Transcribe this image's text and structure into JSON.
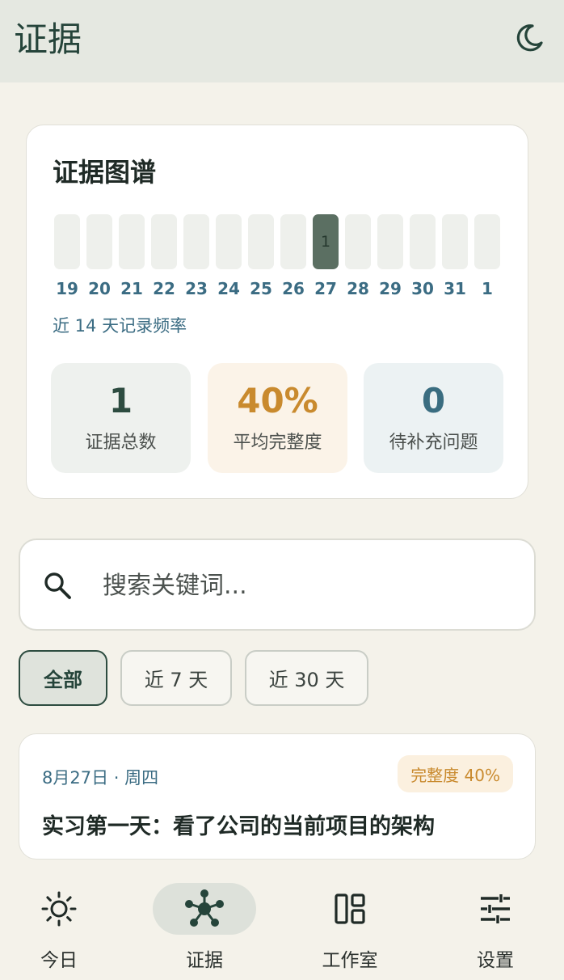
{
  "app_bar": {
    "title": "证据",
    "theme_toggle_icon": "moon-icon"
  },
  "evidence_card": {
    "title": "证据图谱",
    "heatmap": {
      "days": [
        "19",
        "20",
        "21",
        "22",
        "23",
        "24",
        "25",
        "26",
        "27",
        "28",
        "29",
        "30",
        "31",
        "1"
      ],
      "counts": [
        "",
        "",
        "",
        "",
        "",
        "",
        "",
        "",
        "1",
        "",
        "",
        "",
        "",
        ""
      ],
      "active_index": 8
    },
    "frequency_caption": "近 14 天记录频率",
    "stats": [
      {
        "value": "1",
        "label": "证据总数"
      },
      {
        "value": "40%",
        "label": "平均完整度"
      },
      {
        "value": "0",
        "label": "待补充问题"
      }
    ]
  },
  "search": {
    "placeholder": "搜索关键词...",
    "value": "",
    "icon": "search-icon"
  },
  "filters": [
    {
      "label": "全部",
      "active": true
    },
    {
      "label": "近 7 天",
      "active": false
    },
    {
      "label": "近 30 天",
      "active": false
    }
  ],
  "entries": [
    {
      "date": "8月27日 · 周四",
      "completeness": "完整度 40%",
      "title": "实习第一天：看了公司的当前项目的架构"
    }
  ],
  "bottom_nav": [
    {
      "label": "今日",
      "icon": "sun-icon",
      "active": false
    },
    {
      "label": "证据",
      "icon": "graph-network-icon",
      "active": true
    },
    {
      "label": "工作室",
      "icon": "dashboard-icon",
      "active": false
    },
    {
      "label": "设置",
      "icon": "sliders-icon",
      "active": false
    }
  ],
  "colors": {
    "primary": "#2d4c40",
    "accent_orange": "#c98a2e",
    "accent_blue": "#3b6c83",
    "background": "#f4f2ea"
  }
}
